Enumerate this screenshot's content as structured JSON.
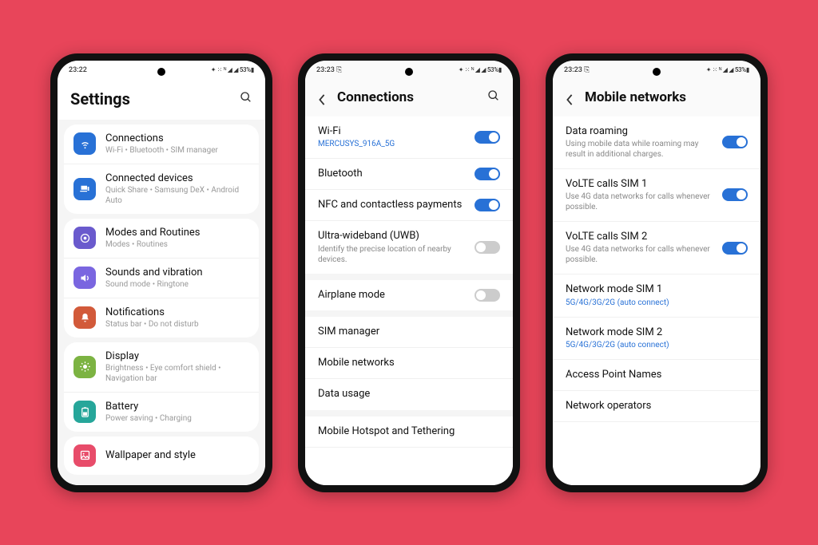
{
  "status": {
    "time1": "23:22",
    "time2": "23:23 ⎘",
    "time3": "23:23 ⎘",
    "right": "✦ ⁙ ᴺ ◢ ◢ 53%▮"
  },
  "screen1": {
    "title": "Settings",
    "groups": [
      {
        "items": [
          {
            "icon": "wifi",
            "color": "#2871d6",
            "label": "Connections",
            "sub": "Wi-Fi • Bluetooth • SIM manager"
          },
          {
            "icon": "devices",
            "color": "#2871d6",
            "label": "Connected devices",
            "sub": "Quick Share • Samsung DeX • Android Auto"
          }
        ]
      },
      {
        "items": [
          {
            "icon": "routines",
            "color": "#6a5acd",
            "label": "Modes and Routines",
            "sub": "Modes • Routines"
          },
          {
            "icon": "sound",
            "color": "#7a66e0",
            "label": "Sounds and vibration",
            "sub": "Sound mode • Ringtone"
          },
          {
            "icon": "notif",
            "color": "#d25a3a",
            "label": "Notifications",
            "sub": "Status bar • Do not disturb"
          }
        ]
      },
      {
        "items": [
          {
            "icon": "display",
            "color": "#7cb342",
            "label": "Display",
            "sub": "Brightness • Eye comfort shield • Navigation bar"
          },
          {
            "icon": "battery",
            "color": "#26a69a",
            "label": "Battery",
            "sub": "Power saving • Charging"
          }
        ]
      },
      {
        "items": [
          {
            "icon": "wallpaper",
            "color": "#e84c6a",
            "label": "Wallpaper and style",
            "sub": ""
          }
        ]
      }
    ]
  },
  "screen2": {
    "title": "Connections",
    "items": [
      {
        "label": "Wi-Fi",
        "sub": "MERCUSYS_916A_5G",
        "subLink": true,
        "toggle": "on"
      },
      {
        "label": "Bluetooth",
        "toggle": "on"
      },
      {
        "label": "NFC and contactless payments",
        "toggle": "on"
      },
      {
        "label": "Ultra-wideband (UWB)",
        "sub": "Identify the precise location of nearby devices.",
        "toggle": "off",
        "noborder": true
      },
      {
        "gap": true
      },
      {
        "label": "Airplane mode",
        "toggle": "off",
        "noborder": true
      },
      {
        "gap": true
      },
      {
        "label": "SIM manager"
      },
      {
        "label": "Mobile networks"
      },
      {
        "label": "Data usage",
        "noborder": true
      },
      {
        "gap": true
      },
      {
        "label": "Mobile Hotspot and Tethering"
      }
    ]
  },
  "screen3": {
    "title": "Mobile networks",
    "items": [
      {
        "label": "Data roaming",
        "sub": "Using mobile data while roaming may result in additional charges.",
        "toggle": "on"
      },
      {
        "label": "VoLTE calls SIM 1",
        "sub": "Use 4G data networks for calls whenever possible.",
        "toggle": "on"
      },
      {
        "label": "VoLTE calls SIM 2",
        "sub": "Use 4G data networks for calls whenever possible.",
        "toggle": "on"
      },
      {
        "label": "Network mode SIM 1",
        "sub": "5G/4G/3G/2G (auto connect)",
        "subLink": true
      },
      {
        "label": "Network mode SIM 2",
        "sub": "5G/4G/3G/2G (auto connect)",
        "subLink": true
      },
      {
        "label": "Access Point Names"
      },
      {
        "label": "Network operators"
      }
    ]
  }
}
